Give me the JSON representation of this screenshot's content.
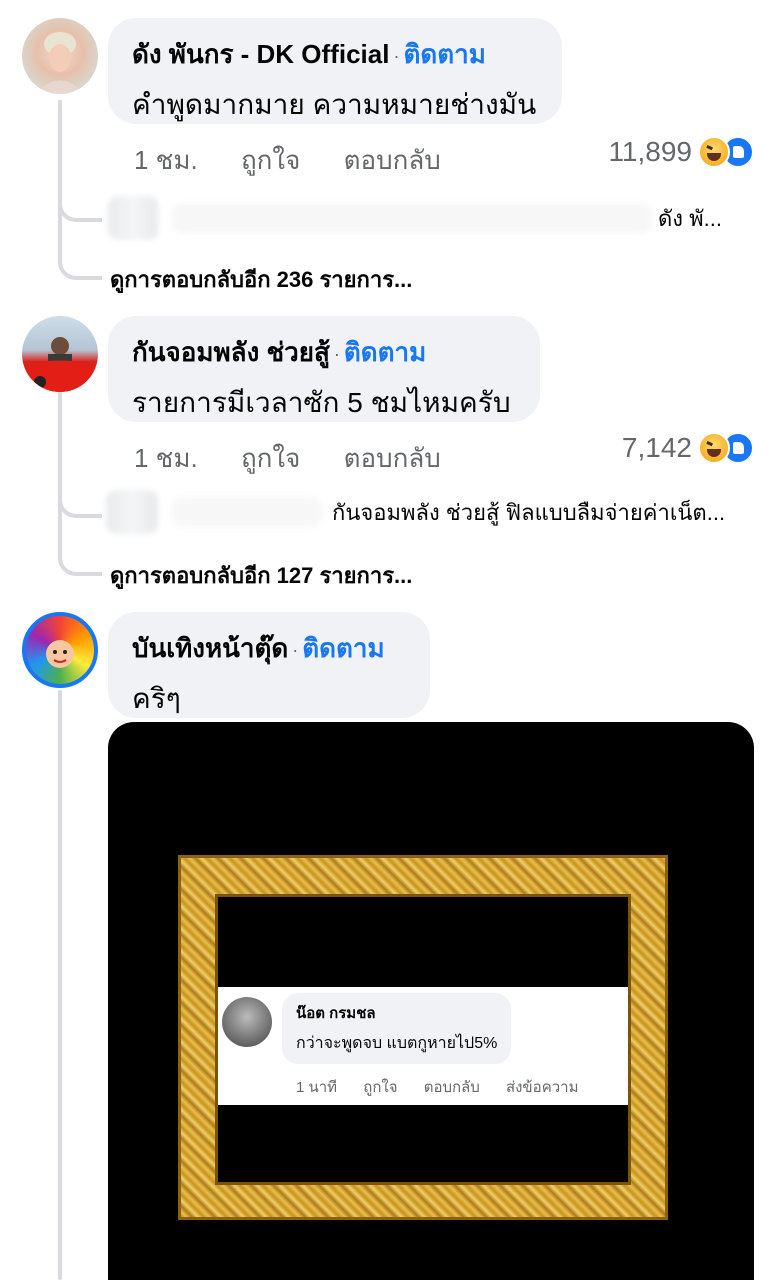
{
  "comments": [
    {
      "author": "ดัง พันกร - DK Official",
      "separator": "·",
      "follow": "ติดตาม",
      "text": "คำพูดมากมาย ความหมายช่างมัน",
      "time": "1 ชม.",
      "like": "ถูกใจ",
      "reply": "ตอบกลับ",
      "reaction_count": "11,899",
      "reply_preview": "ดัง พั...",
      "more_replies": "ดูการตอบกลับอีก 236 รายการ..."
    },
    {
      "author": "กันจอมพลัง ช่วยสู้",
      "separator": "·",
      "follow": "ติดตาม",
      "text": "รายการมีเวลาซัก 5 ชมไหมครับ",
      "time": "1 ชม.",
      "like": "ถูกใจ",
      "reply": "ตอบกลับ",
      "reaction_count": "7,142",
      "reply_preview": "กันจอมพลัง ช่วยสู้ ฟิลแบบลืมจ่ายค่าเน็ต...",
      "more_replies": "ดูการตอบกลับอีก 127 รายการ..."
    },
    {
      "author": "บันเทิงหน้าตุ๊ด",
      "separator": "·",
      "follow": "ติดตาม",
      "text": "คริๆ",
      "media": {
        "author": "น๊อต กรมชล",
        "text": "กว่าจะพูดจบ แบตกูหายไป5%",
        "time": "1 นาที",
        "like": "ถูกใจ",
        "reply": "ตอบกลับ",
        "message": "ส่งข้อความ"
      }
    }
  ],
  "colors": {
    "follow": "#1877f2",
    "bubble": "#f0f2f5",
    "meta": "#65676b",
    "thread": "#d8dadf"
  },
  "icons": [
    "haha-reaction-icon",
    "like-reaction-icon"
  ]
}
